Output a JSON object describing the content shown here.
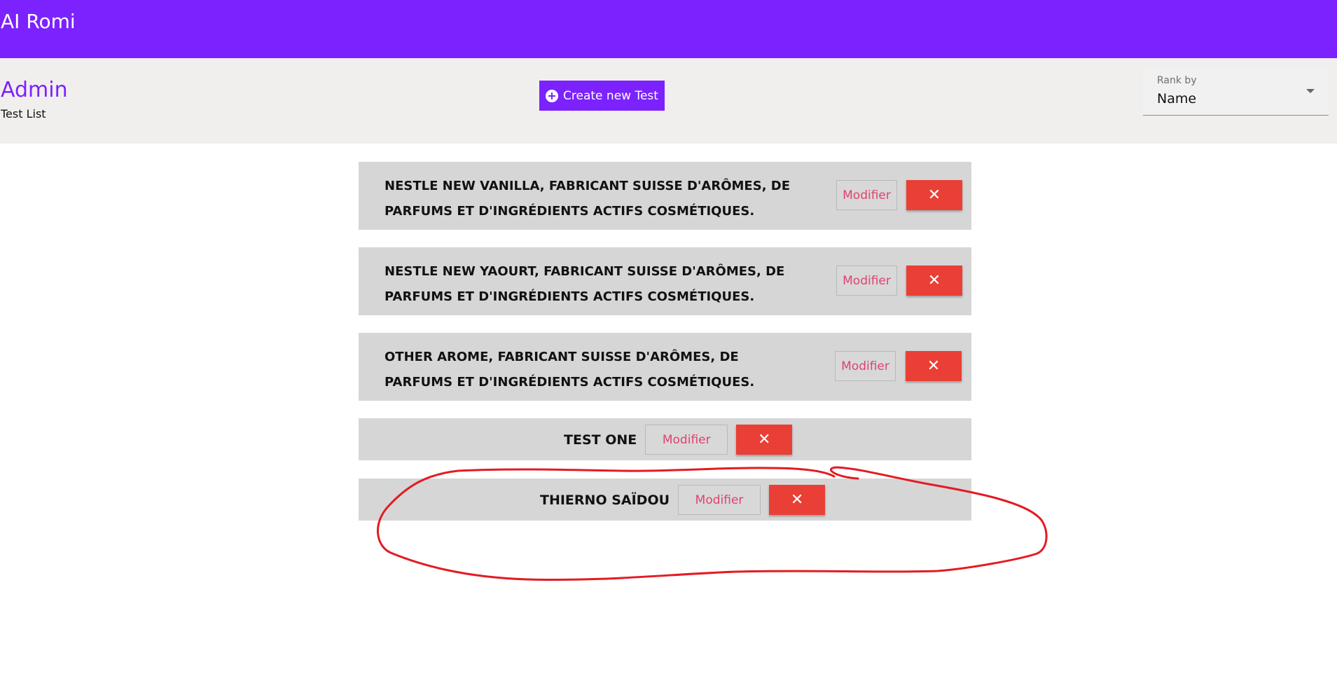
{
  "app": {
    "title": "AI Romi"
  },
  "header": {
    "title": "Admin",
    "subtitle": "Test List",
    "create_button_label": "Create new Test"
  },
  "rank_select": {
    "label": "Rank by",
    "value": "Name"
  },
  "tests": [
    {
      "title": "NESTLE NEW VANILLA, FABRICANT SUISSE D'ARÔMES, DE PARFUMS ET D'INGRÉDIENTS ACTIFS COSMÉTIQUES.",
      "modifier_label": "Modifier",
      "delete_label": "✕"
    },
    {
      "title": "NESTLE NEW YAOURT, FABRICANT SUISSE D'ARÔMES, DE PARFUMS ET D'INGRÉDIENTS ACTIFS COSMÉTIQUES.",
      "modifier_label": "Modifier",
      "delete_label": "✕"
    },
    {
      "title": "OTHER AROME, FABRICANT SUISSE D'ARÔMES, DE PARFUMS ET D'INGRÉDIENTS ACTIFS COSMÉTIQUES.",
      "modifier_label": "Modifier",
      "delete_label": "✕"
    },
    {
      "title": "TEST ONE",
      "modifier_label": "Modifier",
      "delete_label": "✕"
    },
    {
      "title": "THIERNO SAÏDOU",
      "modifier_label": "Modifier",
      "delete_label": "✕"
    }
  ],
  "colors": {
    "primary": "#7b22ff",
    "subheader": "#f0efed",
    "card": "#d6d6d6",
    "danger": "#ea3f36",
    "modifier_text": "#e0426f",
    "annotation": "#e31b23"
  },
  "icons": {
    "create": "plus-circle-icon",
    "rank": "chevron-down-icon",
    "delete": "close-icon"
  }
}
